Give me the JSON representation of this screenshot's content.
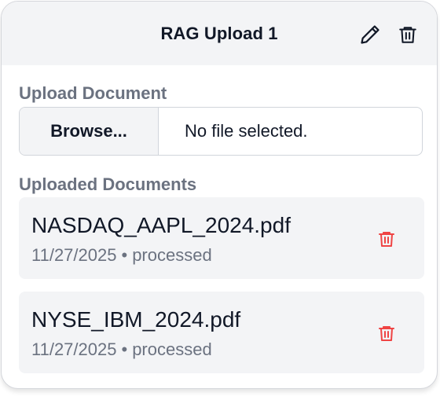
{
  "card": {
    "title": "RAG Upload 1",
    "edit_icon": "pencil-icon",
    "delete_icon": "trash-icon"
  },
  "upload": {
    "section_label": "Upload Document",
    "browse_label": "Browse...",
    "file_status": "No file selected."
  },
  "documents": {
    "section_label": "Uploaded Documents",
    "items": [
      {
        "name": "NASDAQ_AAPL_2024.pdf",
        "date": "11/27/2025",
        "separator": "•",
        "status": "processed",
        "delete_icon": "trash-icon"
      },
      {
        "name": "NYSE_IBM_2024.pdf",
        "date": "11/27/2025",
        "separator": "•",
        "status": "processed",
        "delete_icon": "trash-icon"
      }
    ]
  },
  "colors": {
    "header_bg": "#f3f4f6",
    "title": "#111827",
    "muted": "#6b7280",
    "danger": "#ef4444"
  }
}
